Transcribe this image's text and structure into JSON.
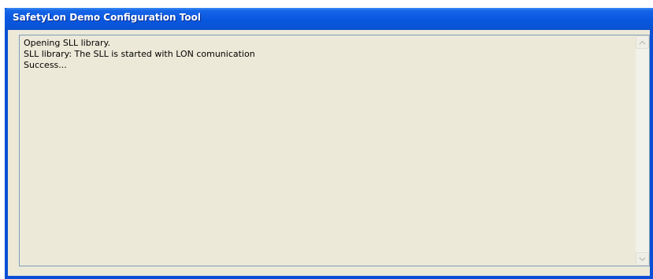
{
  "window": {
    "title": "SafetyLon Demo Configuration Tool"
  },
  "log": {
    "lines": [
      "Opening SLL library.",
      "SLL library: The SLL is started with LON comunication",
      "Success..."
    ]
  },
  "icons": {
    "scroll_up": "chevron-up-icon",
    "scroll_down": "chevron-down-icon"
  },
  "colors": {
    "titlebar": "#0a58e0",
    "window_frame": "#0b4fd6",
    "client_bg": "#ece9d8",
    "textarea_border": "#7f9db9"
  }
}
